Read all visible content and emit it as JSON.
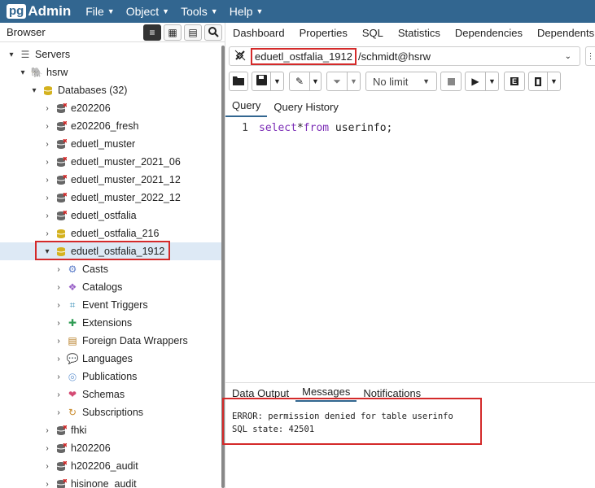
{
  "app": {
    "logo_pg": "pg",
    "logo_admin": "Admin"
  },
  "menu": [
    {
      "label": "File"
    },
    {
      "label": "Object"
    },
    {
      "label": "Tools"
    },
    {
      "label": "Help"
    }
  ],
  "browser": {
    "title": "Browser"
  },
  "tree": {
    "servers": "Servers",
    "server": "hsrw",
    "databases": "Databases (32)",
    "dbs_before": [
      {
        "label": "e202206",
        "disconnected": true
      },
      {
        "label": "e202206_fresh",
        "disconnected": true
      },
      {
        "label": "eduetl_muster",
        "disconnected": true
      },
      {
        "label": "eduetl_muster_2021_06",
        "disconnected": true
      },
      {
        "label": "eduetl_muster_2021_12",
        "disconnected": true
      },
      {
        "label": "eduetl_muster_2022_12",
        "disconnected": true
      },
      {
        "label": "eduetl_ostfalia",
        "disconnected": true
      },
      {
        "label": "eduetl_ostfalia_216",
        "disconnected": false
      }
    ],
    "selected_db": "eduetl_ostfalia_1912",
    "children": [
      {
        "label": "Casts",
        "icon": "casts-icon"
      },
      {
        "label": "Catalogs",
        "icon": "catalogs-icon"
      },
      {
        "label": "Event Triggers",
        "icon": "event-triggers-icon"
      },
      {
        "label": "Extensions",
        "icon": "extensions-icon"
      },
      {
        "label": "Foreign Data Wrappers",
        "icon": "foreign-data-wrappers-icon"
      },
      {
        "label": "Languages",
        "icon": "languages-icon"
      },
      {
        "label": "Publications",
        "icon": "publications-icon"
      },
      {
        "label": "Schemas",
        "icon": "schemas-icon"
      },
      {
        "label": "Subscriptions",
        "icon": "subscriptions-icon"
      }
    ],
    "dbs_after": [
      {
        "label": "fhki",
        "disconnected": true
      },
      {
        "label": "h202206",
        "disconnected": true
      },
      {
        "label": "h202206_audit",
        "disconnected": true
      },
      {
        "label": "hisinone_audit",
        "disconnected": true
      }
    ]
  },
  "tabs": [
    {
      "label": "Dashboard"
    },
    {
      "label": "Properties"
    },
    {
      "label": "SQL"
    },
    {
      "label": "Statistics"
    },
    {
      "label": "Dependencies"
    },
    {
      "label": "Dependents"
    }
  ],
  "connection": {
    "database": "eduetl_ostfalia_1912",
    "user": "/schmidt@hsrw"
  },
  "toolbar": {
    "limit": "No limit"
  },
  "query_tabs": [
    {
      "label": "Query"
    },
    {
      "label": "Query History"
    }
  ],
  "editor": {
    "line": "1",
    "kw1": "select",
    "op": "*",
    "kw2": "from",
    "rest": " userinfo;"
  },
  "output_tabs": [
    {
      "label": "Data Output"
    },
    {
      "label": "Messages"
    },
    {
      "label": "Notifications"
    }
  ],
  "messages": {
    "line1": "ERROR:  permission denied for table userinfo",
    "line2": "SQL state: 42501"
  },
  "colors": {
    "nav": "#326690",
    "highlight": "#d42a2a",
    "db": "#d4b21f"
  }
}
